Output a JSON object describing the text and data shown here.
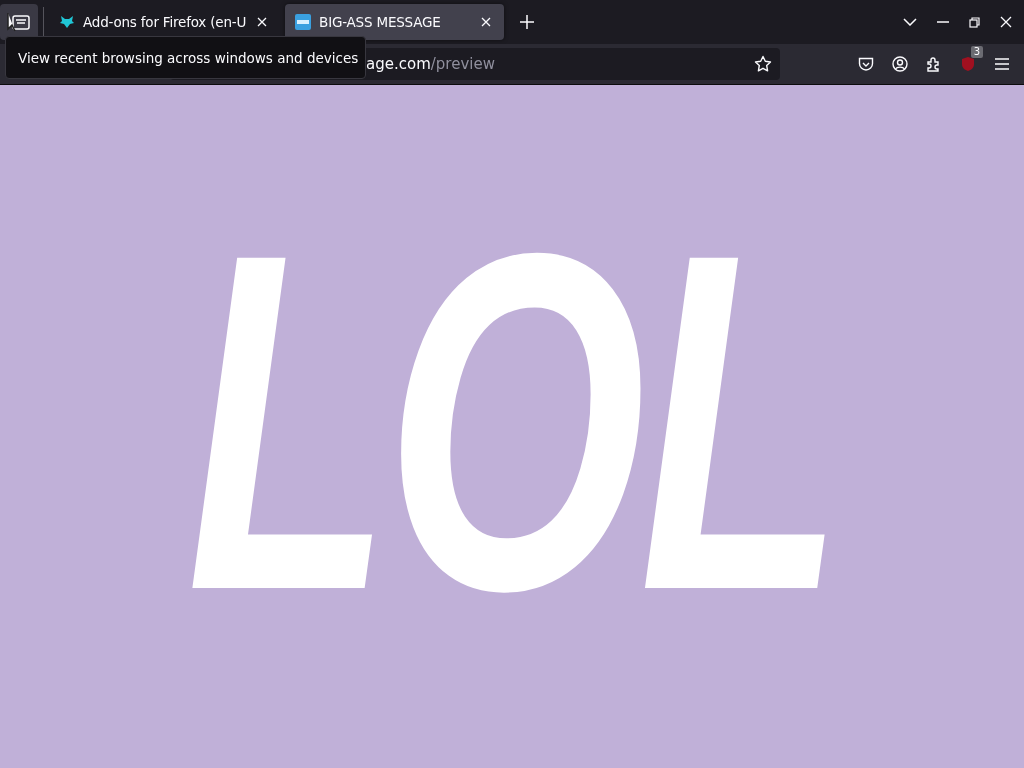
{
  "tabs": [
    {
      "title": "Add-ons for Firefox (en-U",
      "selected": false
    },
    {
      "title": "BIG-ASS MESSAGE",
      "selected": true
    }
  ],
  "tooltip": "View recent browsing across windows and devices",
  "url": {
    "host_tail": "age.com",
    "path": "/preview"
  },
  "extension_badge": "3",
  "page": {
    "message": "LOL"
  }
}
